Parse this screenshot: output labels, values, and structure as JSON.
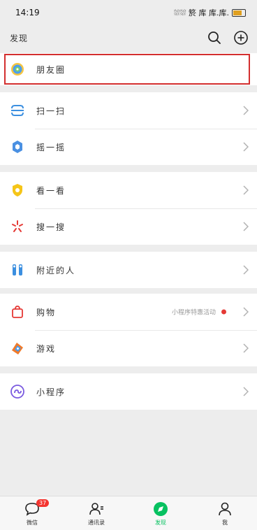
{
  "status": {
    "time": "14:19",
    "indicators": "⛆⛆ 箊 库 库.库."
  },
  "header": {
    "title": "发现"
  },
  "groups": [
    [
      {
        "label": "朋友圈",
        "icon": "moments-icon"
      }
    ],
    [
      {
        "label": "扫一扫",
        "icon": "scan-icon"
      },
      {
        "label": "摇一摇",
        "icon": "shake-icon"
      }
    ],
    [
      {
        "label": "看一看",
        "icon": "top-stories-icon"
      },
      {
        "label": "搜一搜",
        "icon": "search-feature-icon"
      }
    ],
    [
      {
        "label": "附近的人",
        "icon": "people-nearby-icon"
      }
    ],
    [
      {
        "label": "购物",
        "icon": "shopping-bag-icon",
        "extra": "小程序特惠活动"
      },
      {
        "label": "游戏",
        "icon": "games-icon"
      }
    ],
    [
      {
        "label": "小程序",
        "icon": "mini-programs-icon"
      }
    ]
  ],
  "tabs": [
    {
      "label": "微信",
      "icon": "chat-icon",
      "badge": "37"
    },
    {
      "label": "通讯录",
      "icon": "contacts-icon"
    },
    {
      "label": "发现",
      "icon": "discover-icon",
      "active": true
    },
    {
      "label": "我",
      "icon": "me-icon"
    }
  ],
  "colors": {
    "accent": "#07c160",
    "highlight": "#d32f2f",
    "badge": "#f43530"
  }
}
